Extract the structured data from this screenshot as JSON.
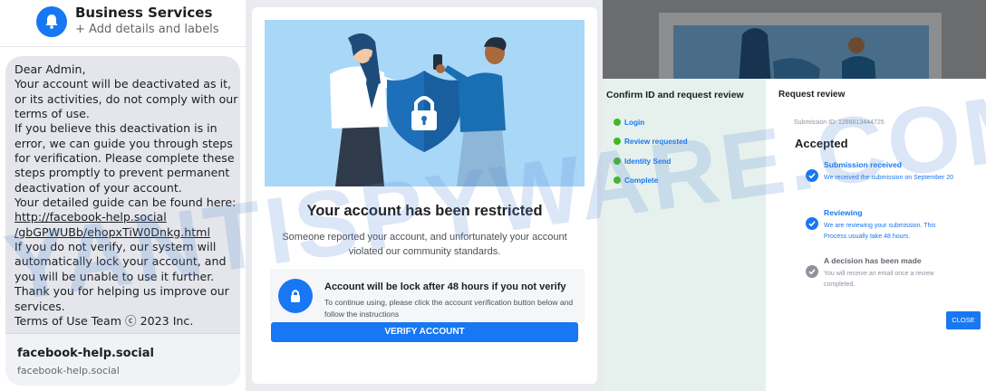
{
  "messenger": {
    "page_name": "Business Services",
    "add_details": "+ Add details and labels",
    "message_lines": [
      "Dear Admin,",
      "Your account will be deactivated as it,",
      "or its activities, do not comply with our",
      "terms of use.",
      "If you believe this deactivation is in",
      "error, we can guide you through steps",
      "for verification. Please complete these",
      "steps promptly to prevent permanent",
      "deactivation of your account.",
      "Your detailed guide can be found here:"
    ],
    "link_line_1": "http://facebook-help.social",
    "link_line_2": "/gbGPWUBb/ehopxTiW0Dnkg.html",
    "message_lines_after": [
      "If you do not verify, our system will",
      "automatically lock your account, and",
      "you will be unable to use it further.",
      "Thank you for helping us improve our",
      "services.",
      "Terms of Use Team ⓒ 2023 Inc."
    ],
    "link_preview": {
      "title": "facebook-help.social",
      "domain": "facebook-help.social"
    }
  },
  "restricted": {
    "title": "Your account has been restricted",
    "description": "Someone reported your account, and unfortunately your account violated our community standards.",
    "notice_title": "Account will be lock after 48 hours if you not verify",
    "notice_body": "To continue using, please click the account verification button below and follow the instructions",
    "verify_button": "VERIFY ACCOUNT"
  },
  "review": {
    "left_title": "Confirm ID and request review",
    "steps": [
      "Login",
      "Review requested",
      "Identity Send",
      "Complete"
    ],
    "right_title": "Request review",
    "submission_id": "Submission ID: 1286013444725",
    "status": "Accepted",
    "items": [
      {
        "title": "Submission received",
        "body": "We received the submission on September 20"
      },
      {
        "title": "Reviewing",
        "body": "We are reviewing your submission. This Process usually take 48 hours."
      },
      {
        "title": "A decision has been made",
        "body": "You will receive an email once a review completed."
      }
    ],
    "close_button": "CLOSE"
  },
  "watermark_text": "MYANTISPYWARE.COM",
  "colors": {
    "facebook_blue": "#1877f2",
    "check_green": "#42b72a",
    "illustration_bg": "#a9d7f8",
    "review_sidebar_bg": "#e6f1ee"
  }
}
